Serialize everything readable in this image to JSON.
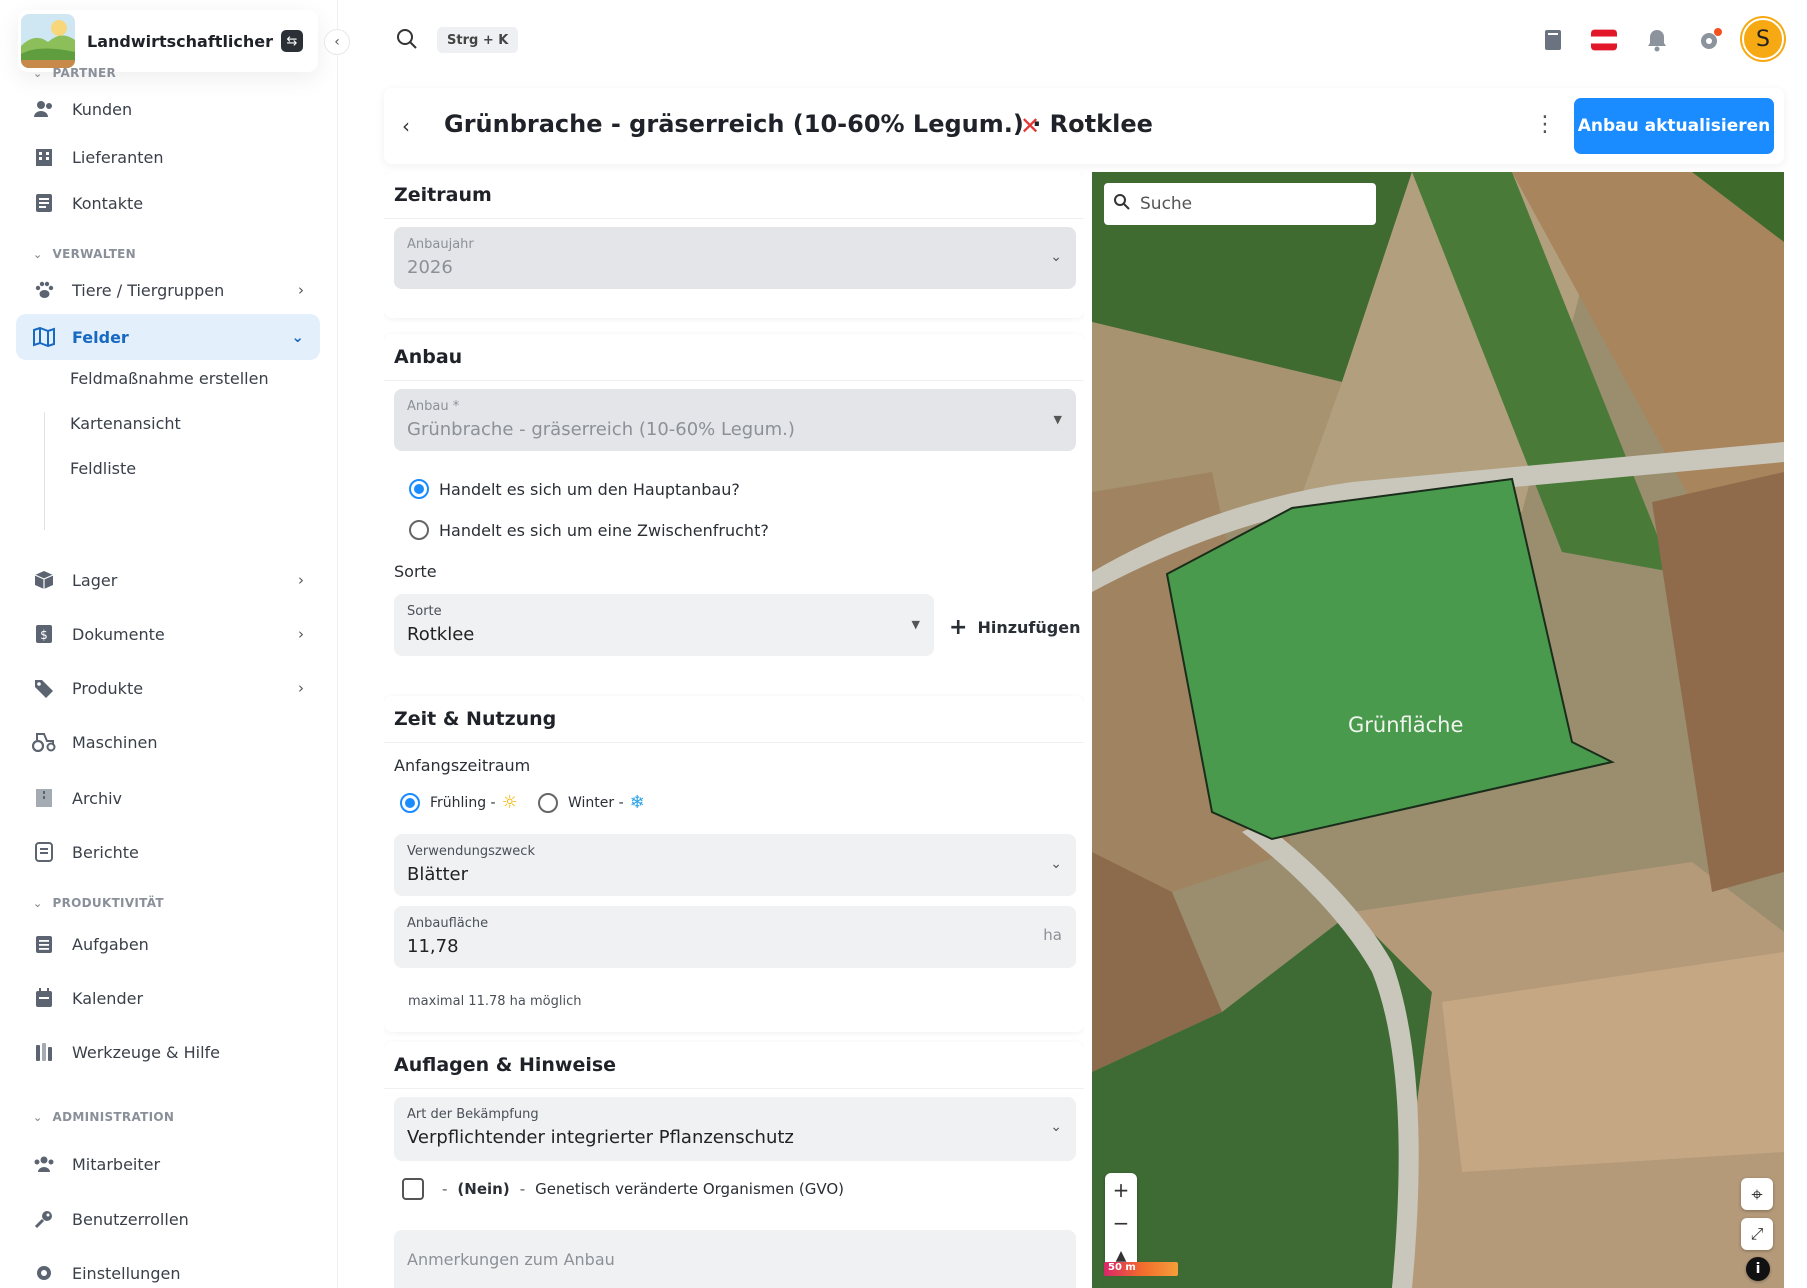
{
  "org": {
    "name": "Landwirtschaftlicher B..."
  },
  "topbar": {
    "shortcut": "Strg + K",
    "avatar_initial": "S",
    "notify_color": "#f4511e"
  },
  "sidebar": {
    "sections": {
      "partner": "PARTNER",
      "verwalten": "VERWALTEN",
      "produktivitaet": "PRODUKTIVITÄT",
      "administration": "ADMINISTRATION"
    },
    "items": {
      "kunden": "Kunden",
      "lieferanten": "Lieferanten",
      "kontakte": "Kontakte",
      "tiere": "Tiere / Tiergruppen",
      "felder": "Felder",
      "feldmassnahme": "Feldmaßnahme erstellen",
      "kartenansicht": "Kartenansicht",
      "feldliste": "Feldliste",
      "lager": "Lager",
      "dokumente": "Dokumente",
      "produkte": "Produkte",
      "maschinen": "Maschinen",
      "archiv": "Archiv",
      "berichte": "Berichte",
      "aufgaben": "Aufgaben",
      "kalender": "Kalender",
      "werkzeuge": "Werkzeuge & Hilfe",
      "mitarbeiter": "Mitarbeiter",
      "benutzerrollen": "Benutzerrollen",
      "einstellungen": "Einstellungen"
    }
  },
  "header": {
    "title": "Grünbrache - gräserreich (10-60% Legum.) · Rotklee",
    "primary_label": "Anbau aktualisieren",
    "accent": "#1a8cff"
  },
  "zeitraum": {
    "heading": "Zeitraum",
    "jahr_label": "Anbaujahr",
    "jahr_value": "2026"
  },
  "anbau": {
    "heading": "Anbau",
    "anbau_label": "Anbau *",
    "anbau_value": "Grünbrache - gräserreich (10-60% Legum.)",
    "haupt_label": "Handelt es sich um den Hauptanbau?",
    "haupt_checked": true,
    "zwischen_label": "Handelt es sich um eine Zwischenfrucht?",
    "sorte_heading": "Sorte",
    "sorte_label": "Sorte",
    "sorte_value": "Rotklee",
    "add_label": "Hinzufügen"
  },
  "nutzung": {
    "heading": "Zeit & Nutzung",
    "anfang_label": "Anfangszeitraum",
    "fruehling": "Frühling -",
    "winter": "Winter -",
    "zweck_label": "Verwendungszweck",
    "zweck_value": "Blätter",
    "flaeche_label": "Anbaufläche",
    "flaeche_value": "11,78",
    "flaeche_unit": "ha",
    "flaeche_hint": "maximal 11.78 ha möglich"
  },
  "auflagen": {
    "heading": "Auflagen & Hinweise",
    "bek_label": "Art der Bekämpfung",
    "bek_value": "Verpflichtender integrierter Pflanzenschutz",
    "gvo_dash1": "-",
    "gvo_nein": "(Nein)",
    "gvo_dash2": "-",
    "gvo_text": "Genetisch veränderte Organismen (GVO)",
    "anmerkungen_placeholder": "Anmerkungen zum Anbau"
  },
  "map": {
    "search_placeholder": "Suche",
    "field_label": "Grünfläche",
    "scale": "50 m",
    "field_color": "#4a9a4e"
  }
}
